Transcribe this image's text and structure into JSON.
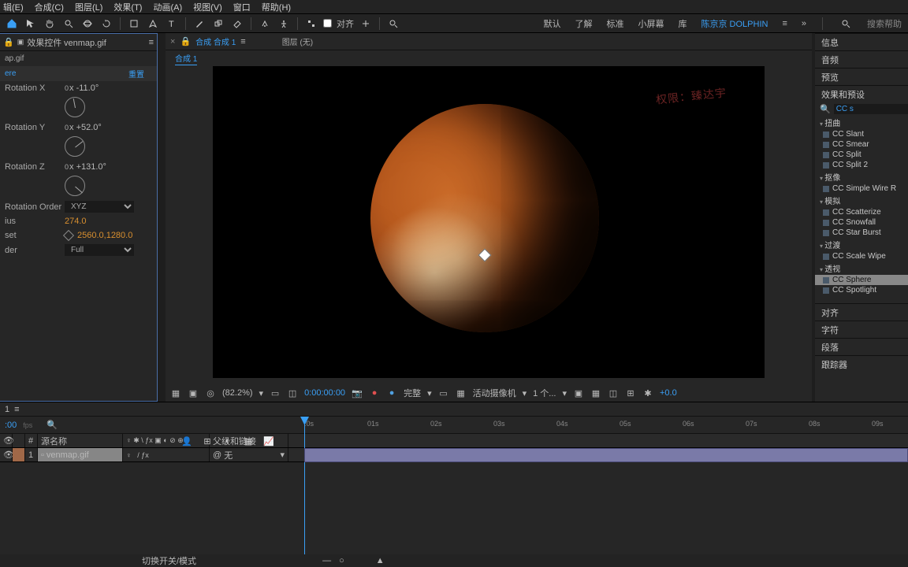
{
  "menu": {
    "items": [
      "辑(E)",
      "合成(C)",
      "图层(L)",
      "效果(T)",
      "动画(A)",
      "视图(V)",
      "窗口",
      "帮助(H)"
    ]
  },
  "workspace": {
    "tabs": [
      "默认",
      "了解",
      "标准",
      "小屏幕",
      "库"
    ],
    "user": "陈京京 DOLPHIN",
    "search_ph": "搜索帮助"
  },
  "left": {
    "tab": "效果控件",
    "file": "venmap.gif",
    "filename": "ap.gif",
    "effect": "ere",
    "reset": "重置",
    "rot_x_label": "Rotation X",
    "rot_x_lead": "0",
    "rot_x_val": "x -11.0°",
    "rot_y_label": "Rotation Y",
    "rot_y_lead": "0",
    "rot_y_val": "x +52.0°",
    "rot_z_label": "Rotation Z",
    "rot_z_lead": "0",
    "rot_z_val": "x +131.0°",
    "rot_order_label": "Rotation Order",
    "rot_order_val": "XYZ",
    "radius_label": "ius",
    "radius_val": "274.0",
    "offset_label": "set",
    "offset_val": "2560.0,1280.0",
    "render_label": "der",
    "render_val": "Full"
  },
  "center": {
    "tab1": "合成 合成 1",
    "layer": "图层 (无)",
    "sub": "合成 1",
    "watermark": "权限：臻达宇",
    "zoom": "(82.2%)",
    "time": "0:00:00:00",
    "complete": "完整",
    "camera": "活动摄像机",
    "views": "1 个...",
    "exposure": "+0.0"
  },
  "right": {
    "panels": [
      "信息",
      "音频",
      "预览",
      "效果和预设"
    ],
    "search": "CC s",
    "cats": [
      "扭曲",
      "抠像",
      "模拟",
      "过渡",
      "透视"
    ],
    "cat0": [
      "CC Slant",
      "CC Smear",
      "CC Split",
      "CC Split 2"
    ],
    "cat1": [
      "CC Simple Wire R"
    ],
    "cat2": [
      "CC Scatterize",
      "CC Snowfall",
      "CC Star Burst"
    ],
    "cat3": [
      "CC Scale Wipe"
    ],
    "cat4": [
      "CC Sphere",
      "CC Spotlight"
    ],
    "below": [
      "对齐",
      "字符",
      "段落",
      "跟踪器"
    ]
  },
  "timeline": {
    "tab": "1",
    "cur_time": ":00",
    "fps": "fps",
    "col_num": "#",
    "col_src": "源名称",
    "col_parent": "父级和链接",
    "row_num": "1",
    "row_file": "venmap.gif",
    "row_parent": "无",
    "ticks": [
      ":0s",
      "01s",
      "02s",
      "03s",
      "04s",
      "05s",
      "06s",
      "07s",
      "08s",
      "09s"
    ],
    "footer": "切换开关/模式"
  }
}
